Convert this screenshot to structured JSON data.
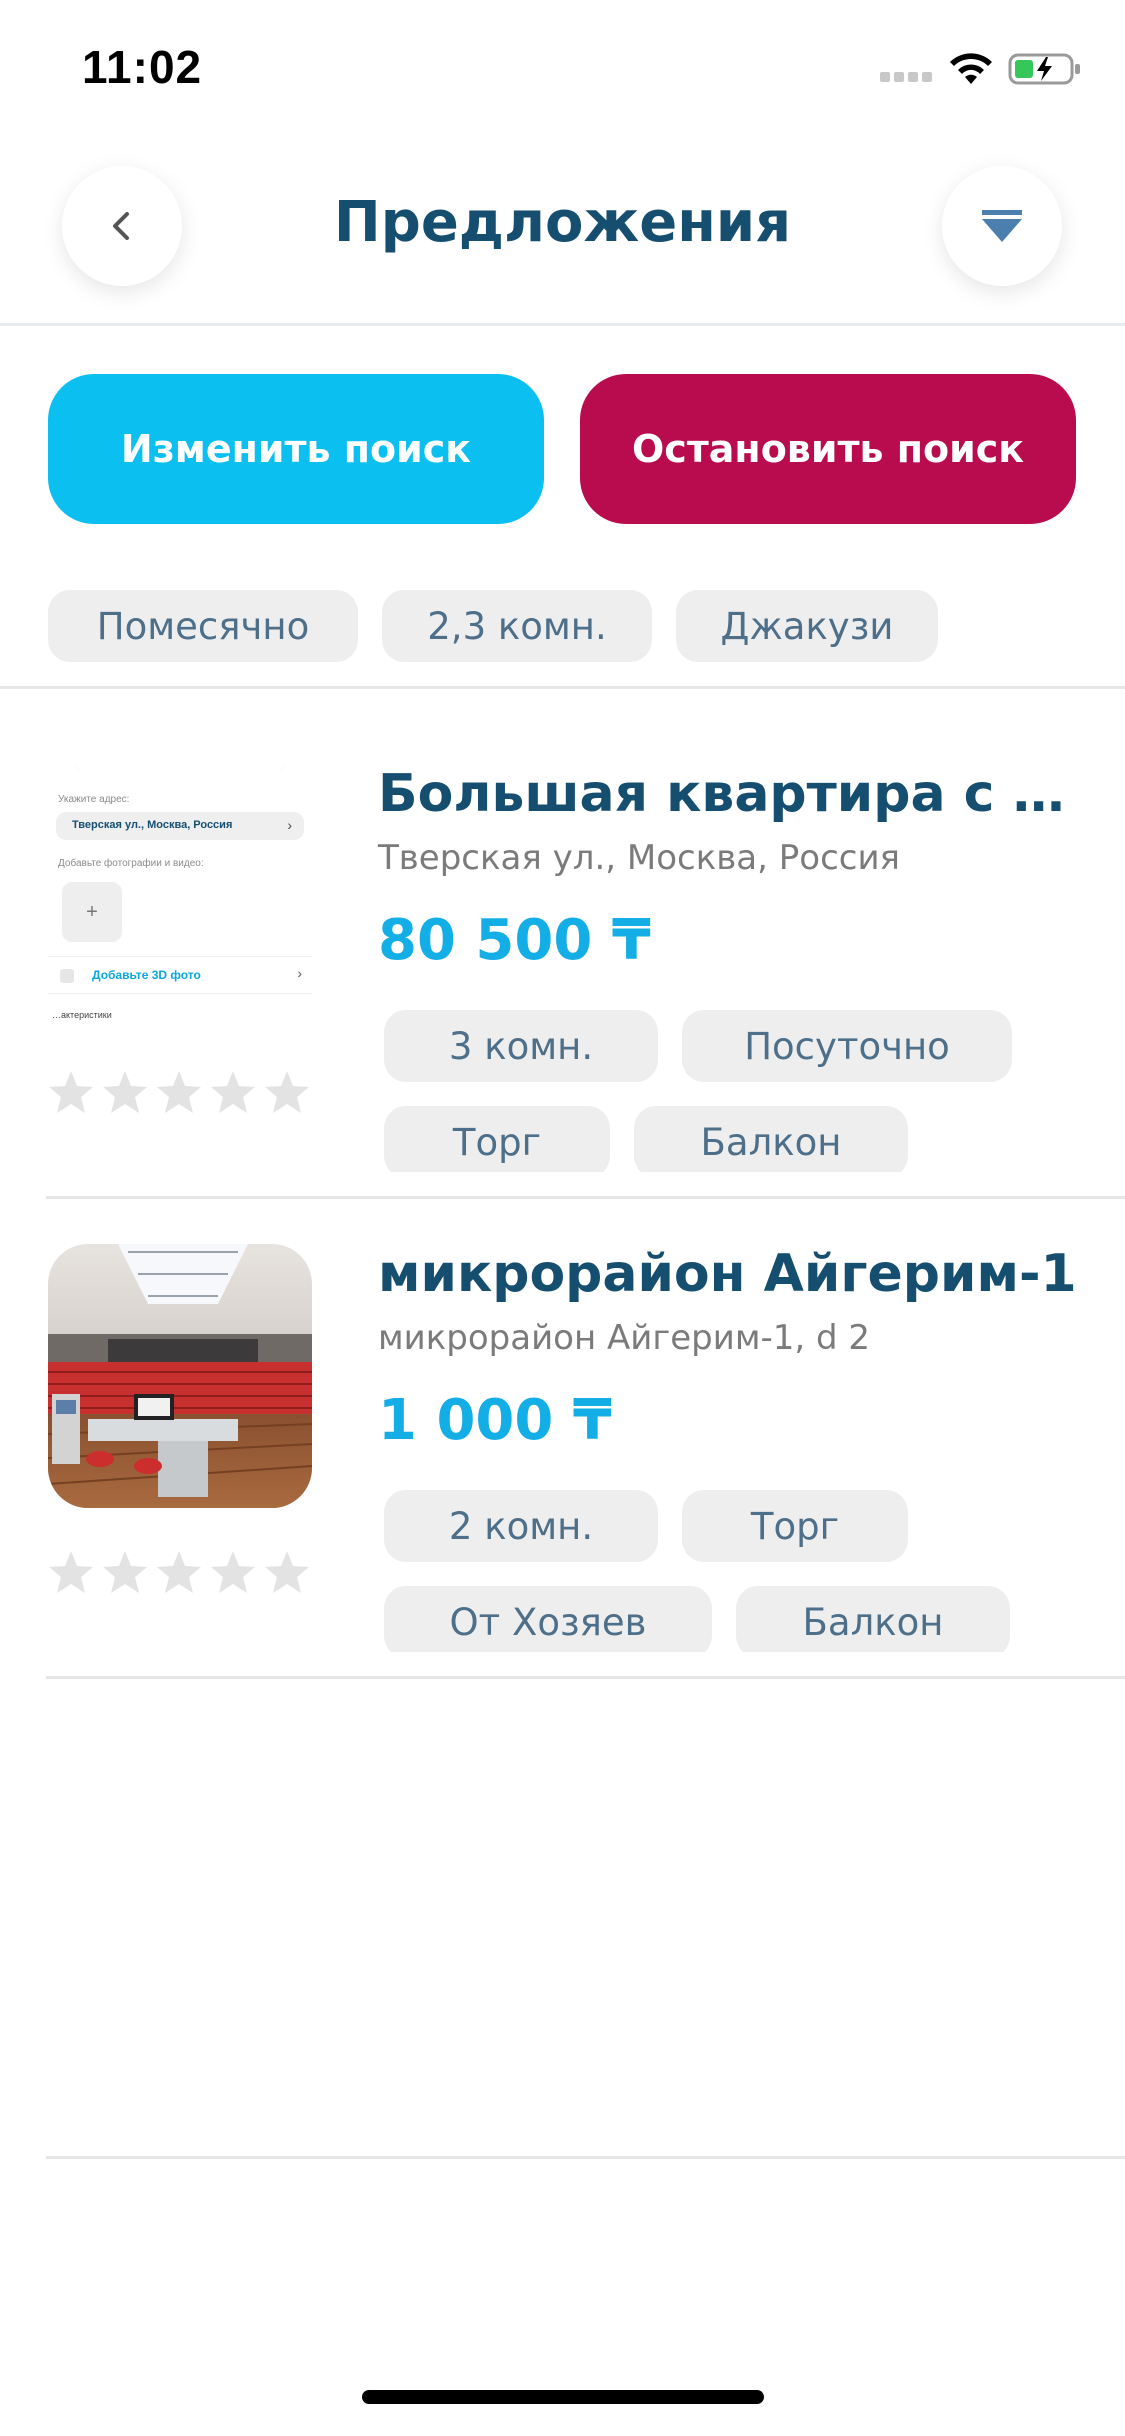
{
  "status_bar": {
    "time": "11:02",
    "signal_icon": "signal-dots-icon",
    "wifi_icon": "wifi-icon",
    "battery_icon": "battery-charging-icon"
  },
  "header": {
    "title": "Предложения",
    "back_icon": "chevron-left-icon",
    "filter_icon": "filter-funnel-icon"
  },
  "actions": {
    "change_search": "Изменить поиск",
    "stop_search": "Остановить поиск"
  },
  "filters": [
    "Помесячно",
    "2,3 комн.",
    "Джакузи"
  ],
  "listings": [
    {
      "title": "Большая квартира с джа...",
      "address": "Тверская ул., Москва, Россия",
      "price": "80 500 ₸",
      "tags": [
        "3 комн.",
        "Посуточно",
        "Торг",
        "Балкон"
      ],
      "rating": 0,
      "thumb_texts": {
        "address_label": "Укажите адрес:",
        "address_value": "Тверская ул., Москва, Россия",
        "media_label": "Добавьте фотографии и видео:",
        "plus": "+",
        "add_3d": "Добавьте 3D фото",
        "chars": "…актеристики"
      }
    },
    {
      "title": "микрорайон Айгерим-1",
      "address": "микрорайон Айгерим-1, d 2",
      "price": "1 000 ₸",
      "tags": [
        "2 комн.",
        "Торг",
        "От Хозяев",
        "Балкон"
      ],
      "rating": 0
    }
  ],
  "colors": {
    "primary_blue": "#0bbff0",
    "stop_red": "#b80c4e",
    "title_navy": "#164e70",
    "price_blue": "#13aee6",
    "chip_bg": "#eeeeee",
    "star_empty": "#e3e3e3"
  }
}
